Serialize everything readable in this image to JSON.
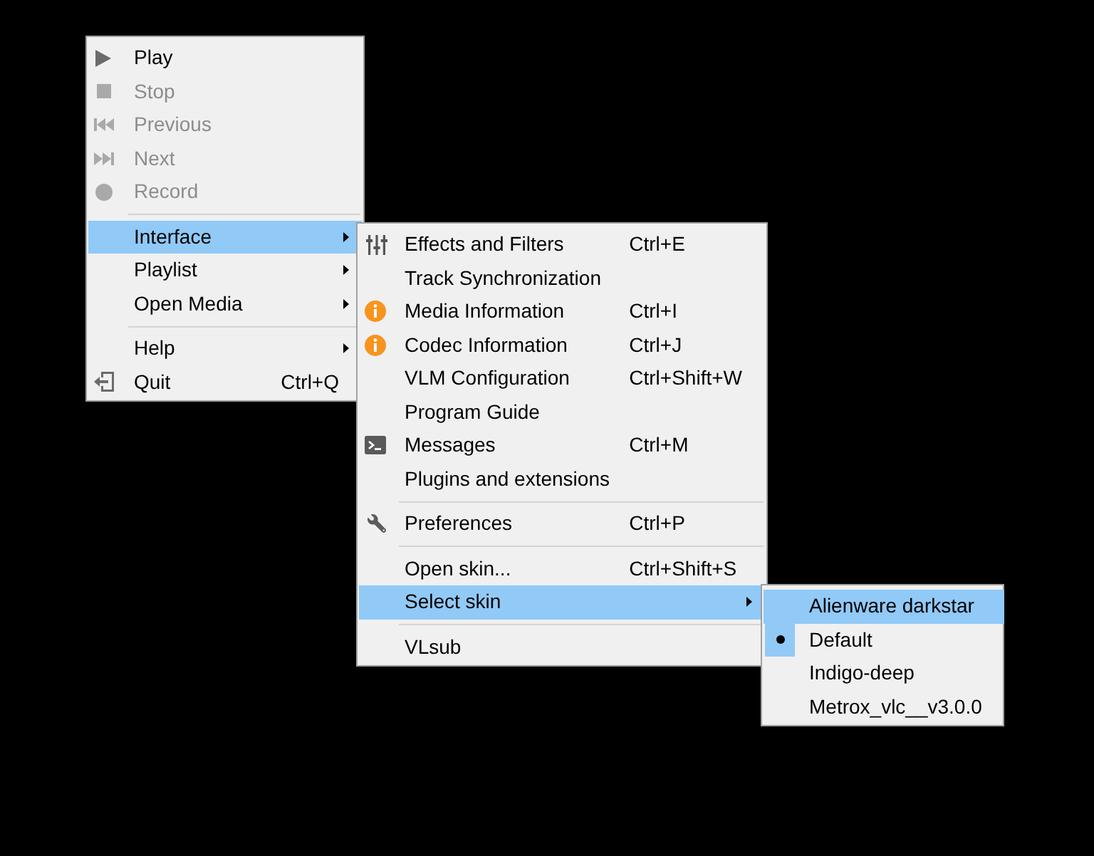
{
  "menus": [
    {
      "sections": [
        [
          {
            "label": "Play",
            "kind": "play",
            "disabled": false,
            "highlighted": false,
            "submenu": false
          },
          {
            "label": "Stop",
            "kind": "stop",
            "disabled": true,
            "highlighted": false,
            "submenu": false
          },
          {
            "label": "Previous",
            "kind": "previous",
            "disabled": true,
            "highlighted": false,
            "submenu": false
          },
          {
            "label": "Next",
            "kind": "next",
            "disabled": true,
            "highlighted": false,
            "submenu": false
          },
          {
            "label": "Record",
            "kind": "record",
            "disabled": true,
            "highlighted": false,
            "submenu": false
          }
        ],
        [
          {
            "label": "Interface",
            "kind": "plain",
            "disabled": false,
            "highlighted": true,
            "submenu": true
          },
          {
            "label": "Playlist",
            "kind": "plain",
            "disabled": false,
            "highlighted": false,
            "submenu": true
          },
          {
            "label": "Open Media",
            "kind": "plain",
            "disabled": false,
            "highlighted": false,
            "submenu": true
          }
        ],
        [
          {
            "label": "Help",
            "kind": "plain",
            "disabled": false,
            "highlighted": false,
            "submenu": true
          },
          {
            "label": "Quit",
            "kind": "quit",
            "shortcut": "Ctrl+Q",
            "disabled": false,
            "highlighted": false,
            "submenu": false
          }
        ]
      ]
    },
    {
      "sections": [
        [
          {
            "label": "Effects and Filters",
            "kind": "effects",
            "shortcut": "Ctrl+E",
            "highlighted": false,
            "submenu": false
          },
          {
            "label": "Track Synchronization",
            "kind": "plain",
            "highlighted": false,
            "submenu": false
          },
          {
            "label": "Media Information",
            "kind": "info",
            "shortcut": "Ctrl+I",
            "highlighted": false,
            "submenu": false
          },
          {
            "label": "Codec Information",
            "kind": "info",
            "shortcut": "Ctrl+J",
            "highlighted": false,
            "submenu": false
          },
          {
            "label": "VLM Configuration",
            "kind": "plain",
            "shortcut": "Ctrl+Shift+W",
            "highlighted": false,
            "submenu": false
          },
          {
            "label": "Program Guide",
            "kind": "plain",
            "highlighted": false,
            "submenu": false
          },
          {
            "label": "Messages",
            "kind": "messages",
            "shortcut": "Ctrl+M",
            "highlighted": false,
            "submenu": false
          },
          {
            "label": "Plugins and extensions",
            "kind": "plain",
            "highlighted": false,
            "submenu": false
          }
        ],
        [
          {
            "label": "Preferences",
            "kind": "wrench",
            "shortcut": "Ctrl+P",
            "highlighted": false,
            "submenu": false
          }
        ],
        [
          {
            "label": "Open skin...",
            "kind": "plain",
            "shortcut": "Ctrl+Shift+S",
            "highlighted": false,
            "submenu": false
          },
          {
            "label": "Select skin",
            "kind": "plain",
            "highlighted": true,
            "submenu": true
          }
        ],
        [
          {
            "label": "VLsub",
            "kind": "plain",
            "highlighted": false,
            "submenu": false
          }
        ]
      ]
    },
    {
      "sections": [
        [
          {
            "label": "Alienware darkstar",
            "highlighted": true,
            "checked": false
          },
          {
            "label": "Default",
            "highlighted": false,
            "checked": true
          },
          {
            "label": "Indigo-deep",
            "highlighted": false,
            "checked": false
          },
          {
            "label": "Metrox_vlc__v3.0.0",
            "highlighted": false,
            "checked": false
          }
        ]
      ]
    }
  ]
}
